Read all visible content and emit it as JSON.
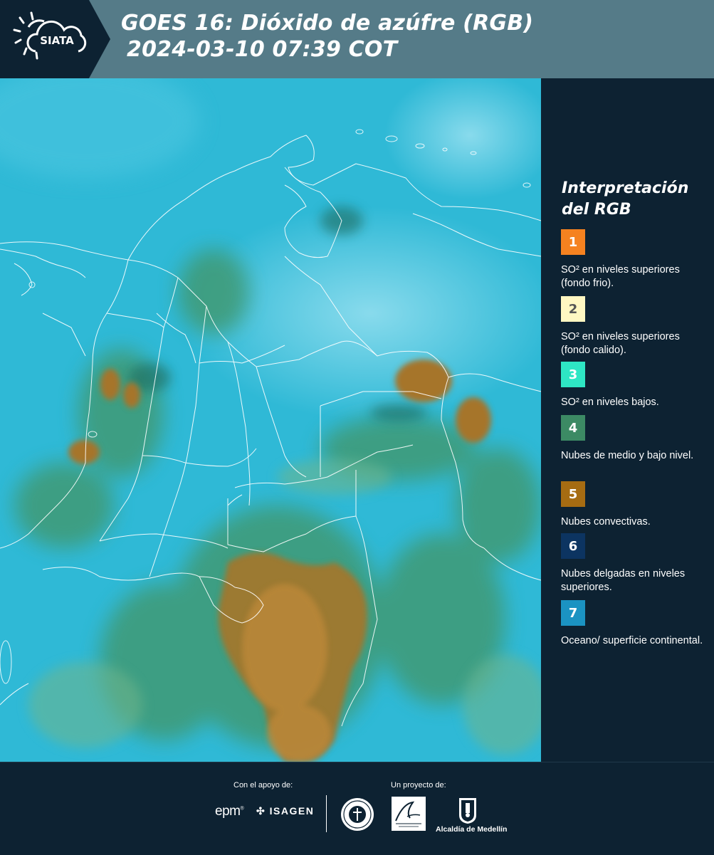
{
  "header": {
    "logo_text": "SIATA",
    "title_line1": "GOES 16: Dióxido de azúfre (RGB)",
    "title_line2": "2024-03-10 07:39 COT",
    "background": "#557b88"
  },
  "legend": {
    "title_line1": "Interpretación",
    "title_line2": "del RGB",
    "items": [
      {
        "number": "1",
        "color": "#f58220",
        "text": "SO² en niveles superiores (fondo frio)."
      },
      {
        "number": "2",
        "color": "#fff7c2",
        "text": "SO² en niveles superiores (fondo calido)."
      },
      {
        "number": "3",
        "color": "#2ee6c4",
        "text": "SO² en niveles bajos."
      },
      {
        "number": "4",
        "color": "#3c8a64",
        "text": "Nubes de medio y bajo nivel."
      },
      {
        "number": "5",
        "color": "#a66c12",
        "text": "Nubes convectivas."
      },
      {
        "number": "6",
        "color": "#0c3461",
        "text": "Nubes delgadas en niveles superiores."
      },
      {
        "number": "7",
        "color": "#1b93c2",
        "text": "Oceano/ superficie continental."
      }
    ]
  },
  "footer": {
    "support_label": "Con el apoyo de:",
    "project_label": "Un proyecto de:",
    "sponsor_1": "epm",
    "sponsor_2": "ISAGEN",
    "partner_3": "Alcaldía de Medellín"
  },
  "map": {
    "background_color": "#2fb9d6",
    "convective_color": "#a6752a",
    "lowcloud_color": "#3f9a74",
    "border_color": "#ffffff"
  }
}
